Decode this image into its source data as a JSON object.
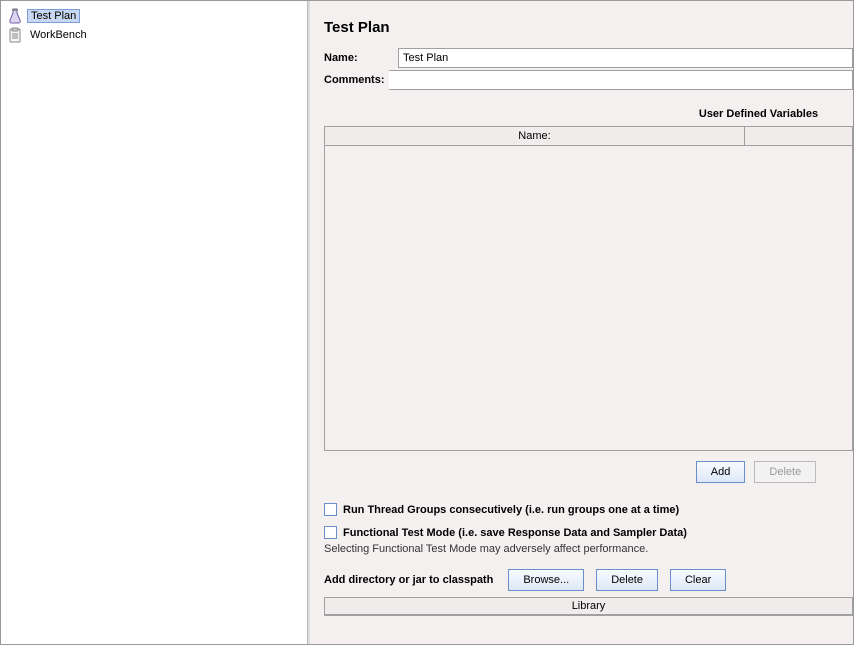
{
  "sidebar": {
    "items": [
      {
        "label": "Test Plan",
        "selected": true
      },
      {
        "label": "WorkBench",
        "selected": false
      }
    ]
  },
  "panel": {
    "title": "Test Plan",
    "name_label": "Name:",
    "name_value": "Test Plan",
    "comments_label": "Comments:",
    "vars_header": "User Defined Variables",
    "col_name": "Name:",
    "btn_add": "Add",
    "btn_delete": "Delete",
    "chk_consecutive": "Run Thread Groups consecutively (i.e. run groups one at a time)",
    "chk_functional": "Functional Test Mode (i.e. save Response Data and Sampler Data)",
    "hint": "Selecting Functional Test Mode may adversely affect performance.",
    "classpath_label": "Add directory or jar to classpath",
    "btn_browse": "Browse...",
    "btn_del2": "Delete",
    "btn_clear": "Clear",
    "library_header": "Library"
  }
}
